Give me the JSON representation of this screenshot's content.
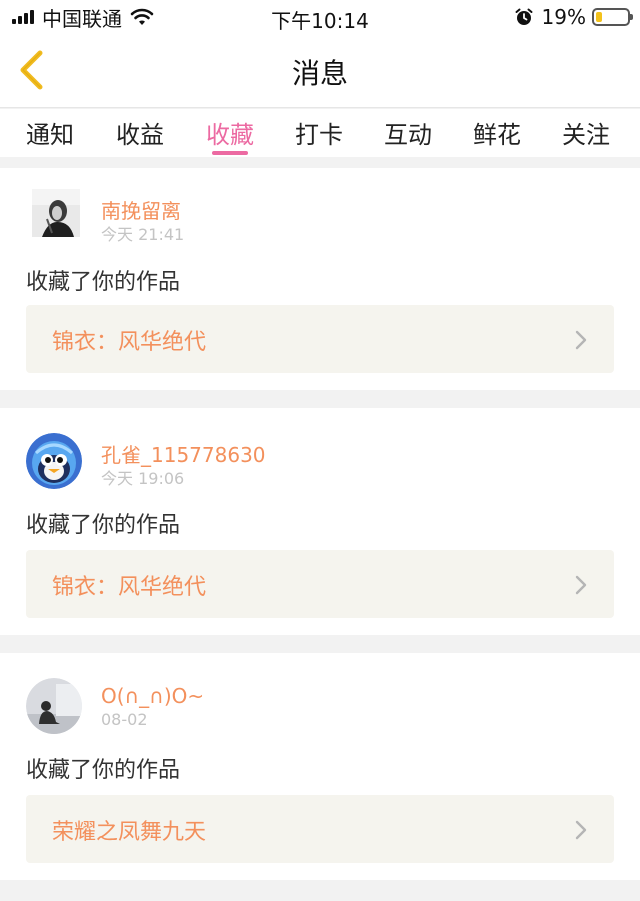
{
  "status_bar": {
    "carrier": "中国联通",
    "time": "下午10:14",
    "battery_percent": "19%",
    "battery_level": 0.19,
    "icons": [
      "signal-icon",
      "wifi-icon",
      "alarm-icon",
      "battery-icon"
    ]
  },
  "header": {
    "title": "消息",
    "back_icon": "chevron-left-icon"
  },
  "tabs": [
    {
      "label": "通知"
    },
    {
      "label": "收益"
    },
    {
      "label": "收藏",
      "active": true
    },
    {
      "label": "打卡"
    },
    {
      "label": "互动"
    },
    {
      "label": "鲜花"
    },
    {
      "label": "关注"
    }
  ],
  "messages": [
    {
      "user": "南挽留离",
      "time": "今天 21:41",
      "action": "收藏了你的作品",
      "work": "锦衣：风华绝代"
    },
    {
      "user": "孔雀_115778630",
      "time": "今天 19:06",
      "action": "收藏了你的作品",
      "work": "锦衣：风华绝代"
    },
    {
      "user": "O(∩_∩)O~",
      "time": "08-02",
      "action": "收藏了你的作品",
      "work": "荣耀之凤舞九天"
    }
  ],
  "colors": {
    "accent_pink": "#ec6aa2",
    "username_orange": "#f3905c",
    "back_yellow": "#f0bb1f",
    "work_bg": "#f5f4ee"
  }
}
